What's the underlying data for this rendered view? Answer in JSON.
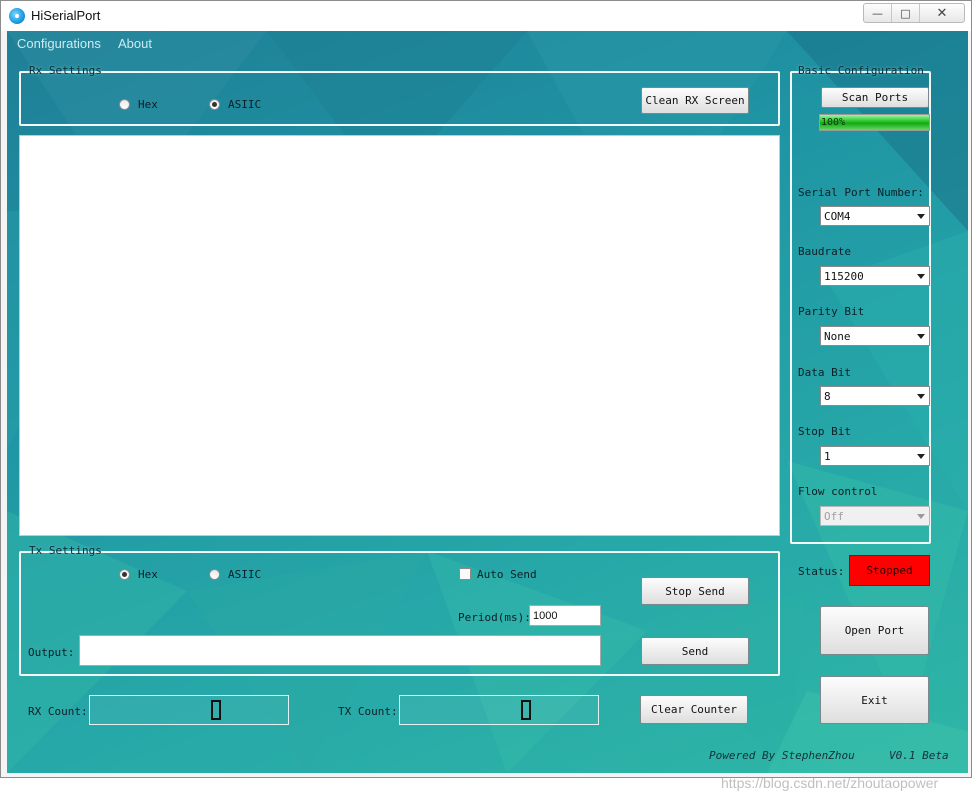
{
  "window": {
    "title": "HiSerialPort"
  },
  "menu": [
    "Configurations",
    "About"
  ],
  "rx_settings": {
    "title": "Rx Settings",
    "radio_hex": "Hex",
    "radio_ascii": "ASIIC",
    "selected": "ASIIC",
    "clean_button": "Clean RX Screen",
    "content": ""
  },
  "tx_settings": {
    "title": "Tx Settings",
    "radio_hex": "Hex",
    "radio_ascii": "ASIIC",
    "selected": "Hex",
    "auto_send_label": "Auto Send",
    "auto_send_checked": false,
    "period_label": "Period(ms):",
    "period_value": "1000",
    "stop_send_button": "Stop Send",
    "output_label": "Output:",
    "output_value": "",
    "send_button": "Send"
  },
  "counters": {
    "rx_label": "RX Count:",
    "rx_value": 0,
    "tx_label": "TX Count:",
    "tx_value": 0,
    "clear_button": "Clear Counter"
  },
  "basic_config": {
    "title": "Basic Configuration",
    "scan_button": "Scan Ports",
    "scan_progress_text": "100%",
    "scan_progress": 1.0,
    "serial_port_label": "Serial Port Number:",
    "serial_port_value": "COM4",
    "baudrate_label": "Baudrate",
    "baudrate_value": "115200",
    "parity_label": "Parity Bit",
    "parity_value": "None",
    "data_bit_label": "Data Bit",
    "data_bit_value": "8",
    "stop_bit_label": "Stop Bit",
    "stop_bit_value": "1",
    "flow_label": "Flow control",
    "flow_value": "Off"
  },
  "status": {
    "label": "Status:",
    "value": "Stopped",
    "color": "#ff0000"
  },
  "actions": {
    "open_port": "Open Port",
    "exit": "Exit"
  },
  "footer": {
    "powered_by": "Powered By StephenZhou",
    "version": "V0.1 Beta"
  },
  "watermark": "https://blog.csdn.net/zhoutaopower",
  "colors": {
    "background_teal": "#23a1a6",
    "progress_green": "#1fc21f"
  }
}
